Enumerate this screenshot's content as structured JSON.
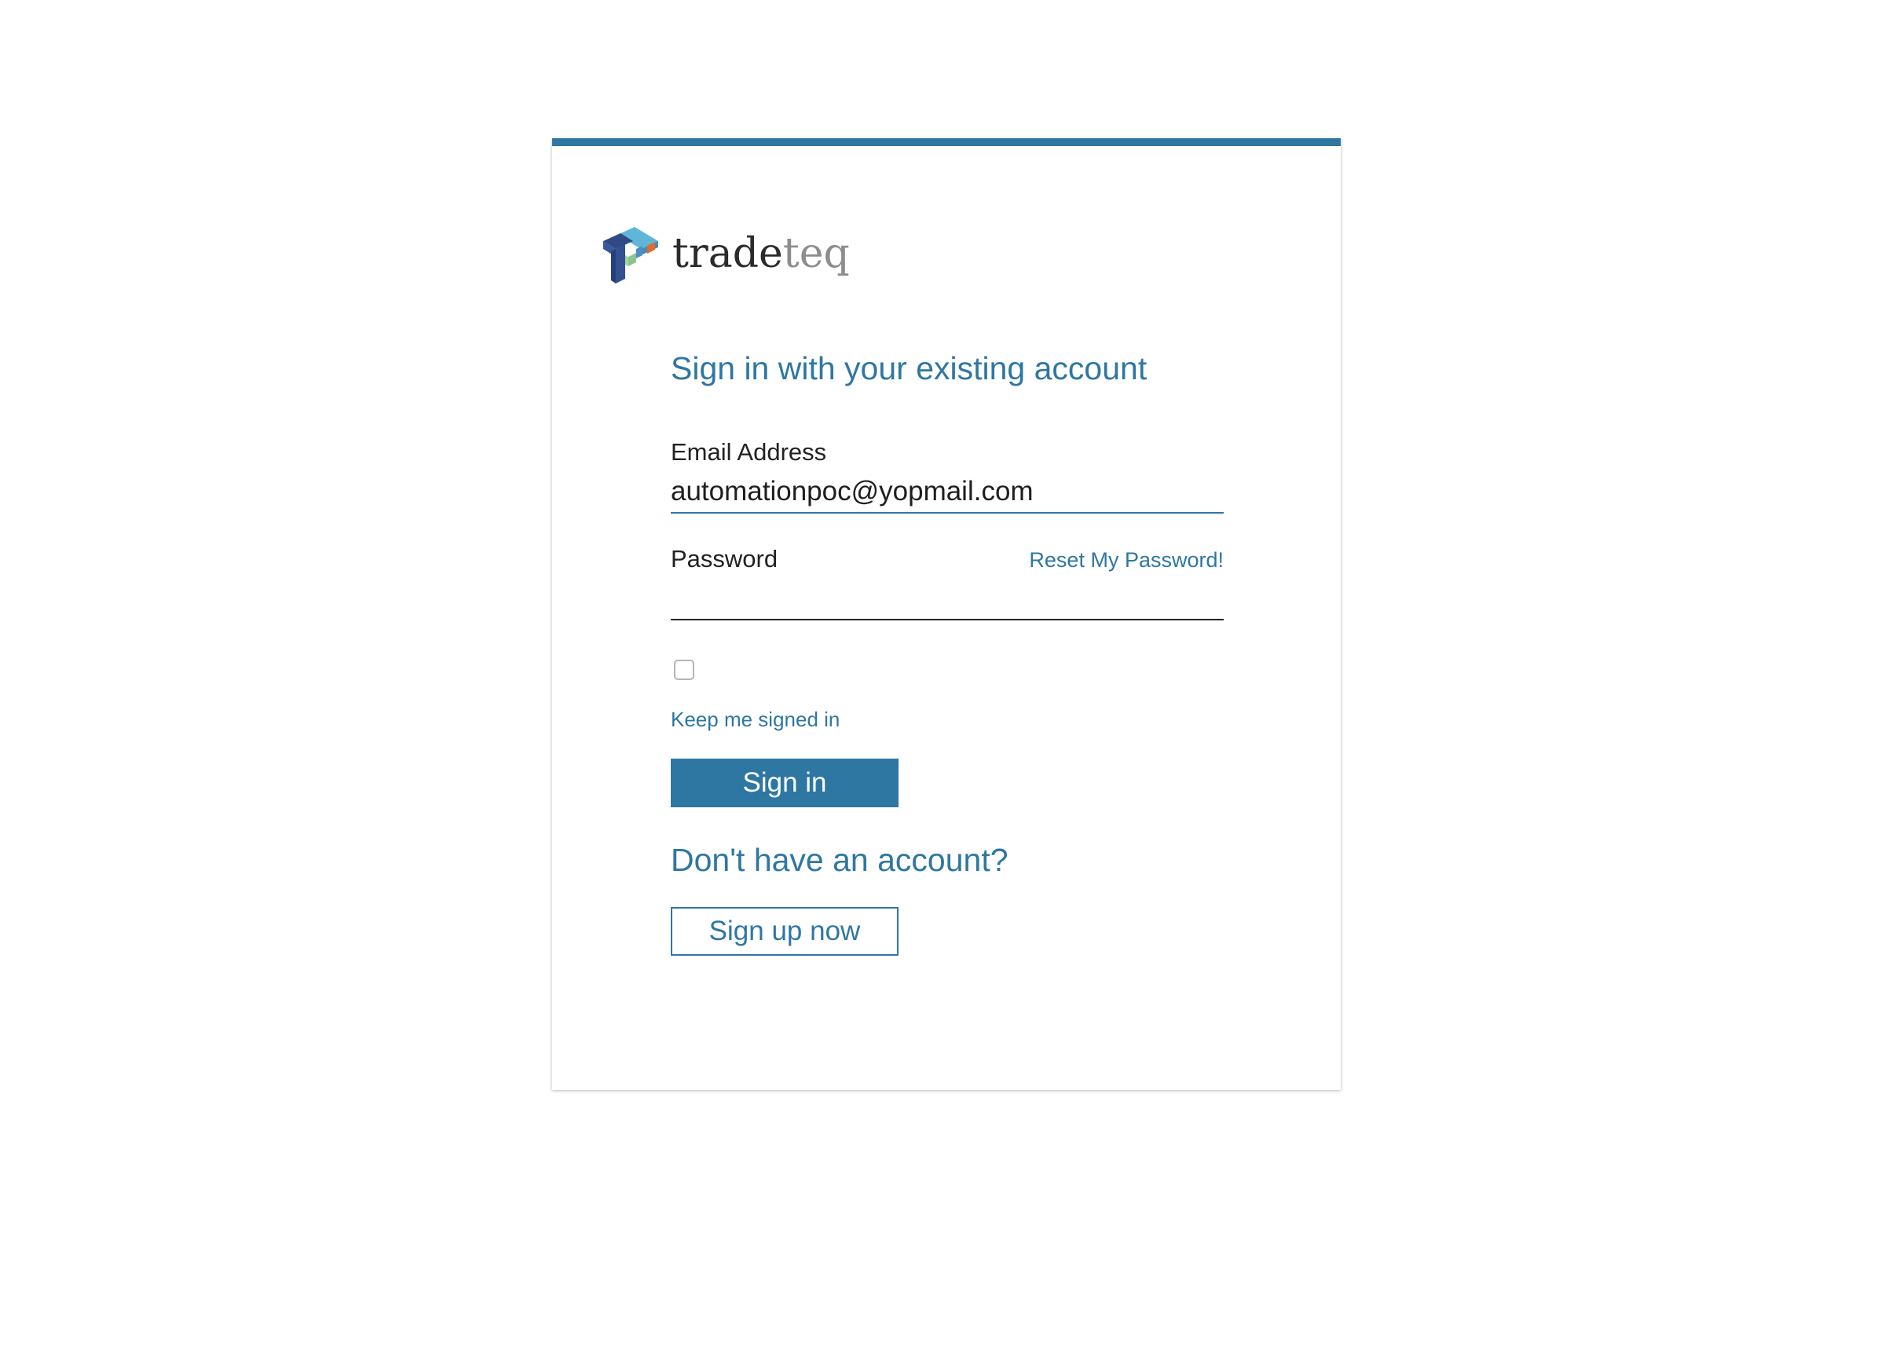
{
  "brand": {
    "name_part1": "trade",
    "name_part2": "teq",
    "colors": {
      "primary": "#2e77a2",
      "logo_dark_blue": "#33508f",
      "logo_light_blue": "#5fb6d9",
      "logo_orange": "#e26a2c",
      "logo_green": "#8cc48e"
    }
  },
  "signin": {
    "heading": "Sign in with your existing account",
    "email_label": "Email Address",
    "email_value": "automationpoc@yopmail.com",
    "password_label": "Password",
    "password_value": "",
    "reset_link": "Reset My Password!",
    "keep_signed_in_label": "Keep me signed in",
    "keep_signed_in_checked": false,
    "signin_button": "Sign in"
  },
  "signup": {
    "heading": "Don't have an account?",
    "button": "Sign up now"
  }
}
